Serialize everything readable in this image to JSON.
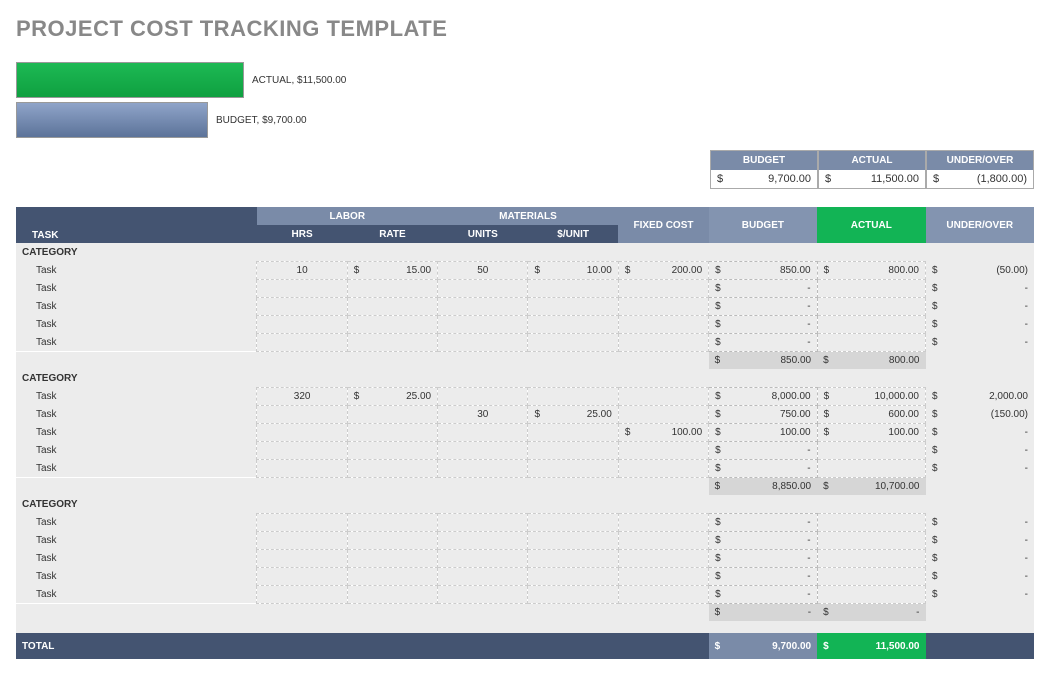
{
  "title": "PROJECT COST TRACKING TEMPLATE",
  "chart_data": {
    "type": "bar",
    "categories": [
      "ACTUAL",
      "BUDGET"
    ],
    "values": [
      11500.0,
      9700.0
    ],
    "labels": [
      "ACTUAL,  $11,500.00",
      "BUDGET,  $9,700.00"
    ]
  },
  "summary": {
    "budget_label": "BUDGET",
    "actual_label": "ACTUAL",
    "uo_label": "UNDER/OVER",
    "budget_value": "9,700.00",
    "actual_value": "11,500.00",
    "uo_value": "(1,800.00)"
  },
  "headers": {
    "task": "TASK",
    "labor": "LABOR",
    "materials": "MATERIALS",
    "fixed": "FIXED COST",
    "budget": "BUDGET",
    "actual": "ACTUAL",
    "uo": "UNDER/OVER",
    "hrs": "HRS",
    "rate": "RATE",
    "units": "UNITS",
    "perunit": "$/UNIT"
  },
  "categories": [
    {
      "name": "CATEGORY",
      "rows": [
        {
          "task": "Task",
          "hrs": "10",
          "rate": "15.00",
          "units": "50",
          "perunit": "10.00",
          "fixed": "200.00",
          "budget": "850.00",
          "actual": "800.00",
          "uo": "(50.00)"
        },
        {
          "task": "Task",
          "hrs": "",
          "rate": "",
          "units": "",
          "perunit": "",
          "fixed": "",
          "budget": "-",
          "actual": "",
          "uo": "-"
        },
        {
          "task": "Task",
          "hrs": "",
          "rate": "",
          "units": "",
          "perunit": "",
          "fixed": "",
          "budget": "-",
          "actual": "",
          "uo": "-"
        },
        {
          "task": "Task",
          "hrs": "",
          "rate": "",
          "units": "",
          "perunit": "",
          "fixed": "",
          "budget": "-",
          "actual": "",
          "uo": "-"
        },
        {
          "task": "Task",
          "hrs": "",
          "rate": "",
          "units": "",
          "perunit": "",
          "fixed": "",
          "budget": "-",
          "actual": "",
          "uo": "-"
        }
      ],
      "subtotal": {
        "budget": "850.00",
        "actual": "800.00"
      }
    },
    {
      "name": "CATEGORY",
      "rows": [
        {
          "task": "Task",
          "hrs": "320",
          "rate": "25.00",
          "units": "",
          "perunit": "",
          "fixed": "",
          "budget": "8,000.00",
          "actual": "10,000.00",
          "uo": "2,000.00"
        },
        {
          "task": "Task",
          "hrs": "",
          "rate": "",
          "units": "30",
          "perunit": "25.00",
          "fixed": "",
          "budget": "750.00",
          "actual": "600.00",
          "uo": "(150.00)"
        },
        {
          "task": "Task",
          "hrs": "",
          "rate": "",
          "units": "",
          "perunit": "",
          "fixed": "100.00",
          "budget": "100.00",
          "actual": "100.00",
          "uo": "-"
        },
        {
          "task": "Task",
          "hrs": "",
          "rate": "",
          "units": "",
          "perunit": "",
          "fixed": "",
          "budget": "-",
          "actual": "",
          "uo": "-"
        },
        {
          "task": "Task",
          "hrs": "",
          "rate": "",
          "units": "",
          "perunit": "",
          "fixed": "",
          "budget": "-",
          "actual": "",
          "uo": "-"
        }
      ],
      "subtotal": {
        "budget": "8,850.00",
        "actual": "10,700.00"
      }
    },
    {
      "name": "CATEGORY",
      "rows": [
        {
          "task": "Task",
          "hrs": "",
          "rate": "",
          "units": "",
          "perunit": "",
          "fixed": "",
          "budget": "-",
          "actual": "",
          "uo": "-"
        },
        {
          "task": "Task",
          "hrs": "",
          "rate": "",
          "units": "",
          "perunit": "",
          "fixed": "",
          "budget": "-",
          "actual": "",
          "uo": "-"
        },
        {
          "task": "Task",
          "hrs": "",
          "rate": "",
          "units": "",
          "perunit": "",
          "fixed": "",
          "budget": "-",
          "actual": "",
          "uo": "-"
        },
        {
          "task": "Task",
          "hrs": "",
          "rate": "",
          "units": "",
          "perunit": "",
          "fixed": "",
          "budget": "-",
          "actual": "",
          "uo": "-"
        },
        {
          "task": "Task",
          "hrs": "",
          "rate": "",
          "units": "",
          "perunit": "",
          "fixed": "",
          "budget": "-",
          "actual": "",
          "uo": "-"
        }
      ],
      "subtotal": {
        "budget": "-",
        "actual": "-"
      }
    }
  ],
  "total": {
    "label": "TOTAL",
    "budget": "9,700.00",
    "actual": "11,500.00"
  },
  "currency": "$"
}
